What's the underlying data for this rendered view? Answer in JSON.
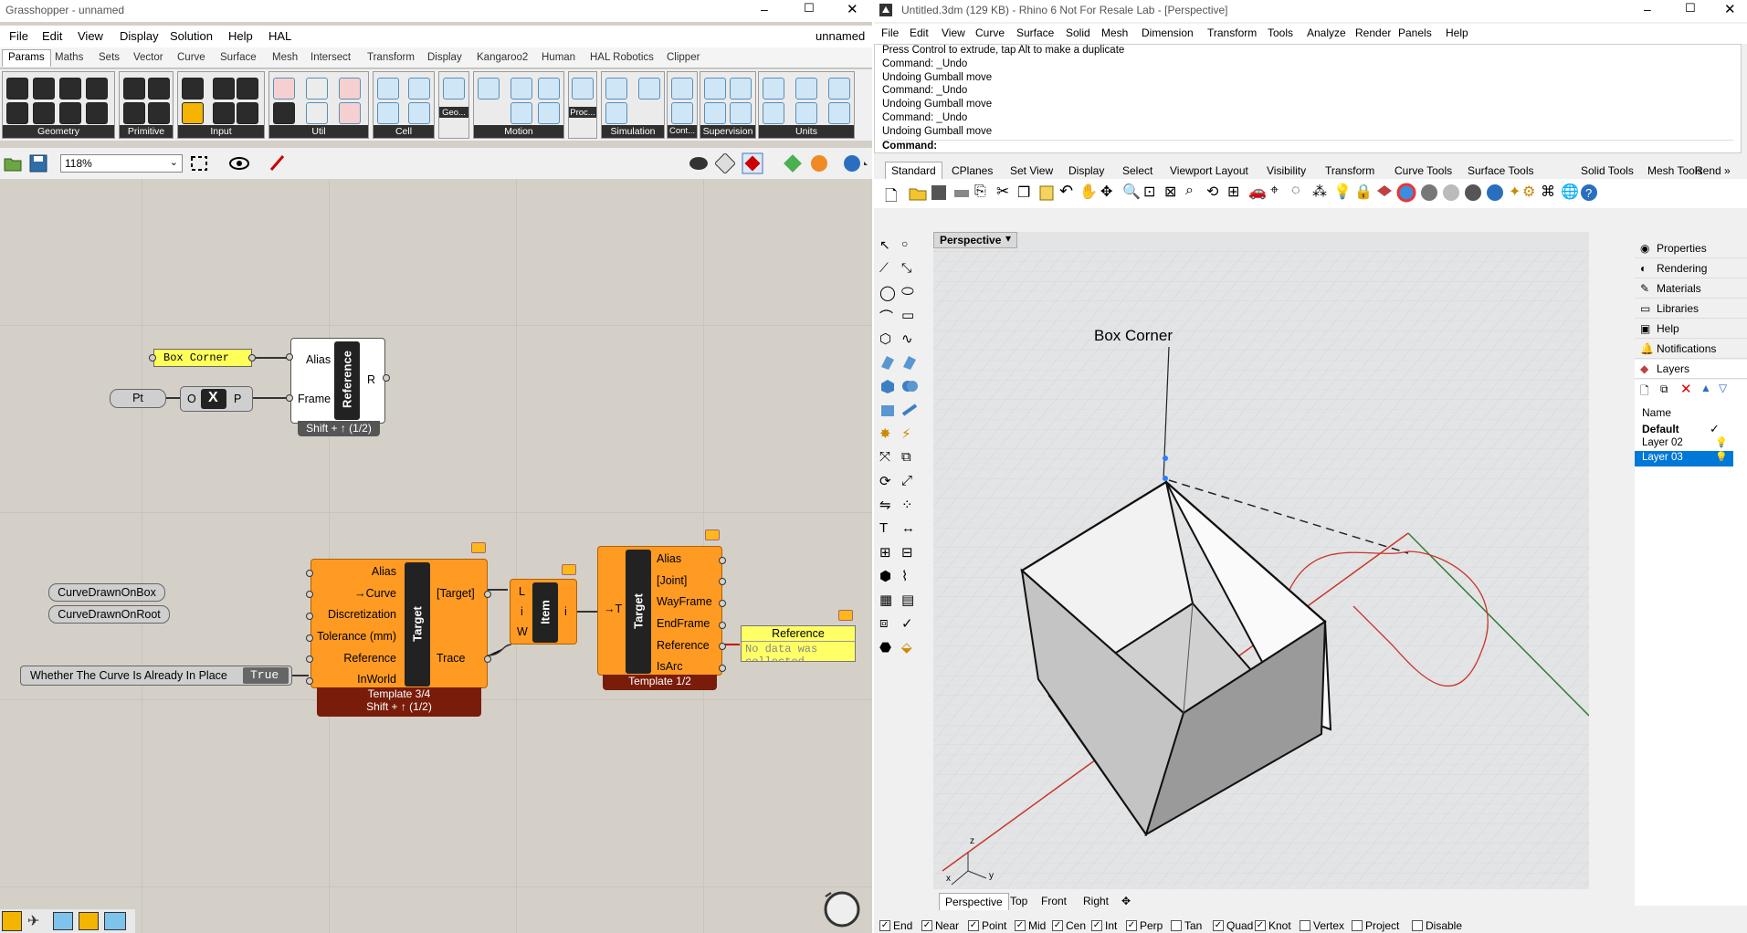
{
  "gh": {
    "title": "Grasshopper - unnamed",
    "doc_name": "unnamed",
    "menu": [
      "File",
      "Edit",
      "View",
      "Display",
      "Solution",
      "Help",
      "HAL"
    ],
    "tabs": [
      "Params",
      "Maths",
      "Sets",
      "Vector",
      "Curve",
      "Surface",
      "Mesh",
      "Intersect",
      "Transform",
      "Display",
      "Kangaroo2",
      "Human",
      "HAL Robotics",
      "Clipper"
    ],
    "groups": [
      "Geometry",
      "Primitive",
      "Input",
      "Util",
      "Cell",
      "Geo...",
      "Motion",
      "Proc...",
      "Simulation",
      "Cont...",
      "Supervision",
      "Units"
    ],
    "zoom": "118%",
    "canvas": {
      "box_corner": "Box Corner",
      "pt": "Pt",
      "x_comp": {
        "o": "O",
        "x": "X",
        "p": "P"
      },
      "ref1": {
        "alias": "Alias",
        "frame": "Frame",
        "cap": "Reference",
        "out": "R",
        "footer": "Shift + ↑ (1/2)"
      },
      "curve1": "CurveDrawnOnBox",
      "curve2": "CurveDrawnOnRoot",
      "bool_label": "Whether The Curve Is Already In Place",
      "bool_val": "True",
      "target1": {
        "inputs": [
          "Alias",
          "→Curve",
          "Discretization",
          "Tolerance (mm)",
          "Reference",
          "InWorld"
        ],
        "cap": "Target",
        "outputs": [
          "[Target]",
          "Trace"
        ],
        "footer1": "Template 3/4",
        "footer2": "Shift + ↑ (1/2)"
      },
      "item": {
        "l": "L",
        "i": "i",
        "w": "W",
        "cap": "Item",
        "out": "i"
      },
      "target2": {
        "input": "→T",
        "cap": "Target",
        "outputs": [
          "Alias",
          "[Joint]",
          "WayFrame",
          "EndFrame",
          "Reference",
          "IsArc"
        ],
        "footer": "Template 1/2"
      },
      "panel": {
        "title": "Reference",
        "text": "No data was collected"
      }
    }
  },
  "rhino": {
    "title": "Untitled.3dm (129 KB) - Rhino 6 Not For Resale Lab - [Perspective]",
    "menu": [
      "File",
      "Edit",
      "View",
      "Curve",
      "Surface",
      "Solid",
      "Mesh",
      "Dimension",
      "Transform",
      "Tools",
      "Analyze",
      "Render",
      "Panels",
      "Help"
    ],
    "history": [
      "Press Control to extrude, tap Alt to make a duplicate",
      "Command: _Undo",
      "Undoing Gumball move",
      "Command: _Undo",
      "Undoing Gumball move",
      "Command: _Undo",
      "Undoing Gumball move"
    ],
    "prompt": "Command:",
    "toolbar_tabs": [
      "Standard",
      "CPlanes",
      "Set View",
      "Display",
      "Select",
      "Viewport Layout",
      "Visibility",
      "Transform",
      "Curve Tools",
      "Surface Tools",
      "Solid Tools",
      "Mesh Tools",
      "Rend »"
    ],
    "viewport_name": "Perspective",
    "annotation": "Box Corner",
    "axes": {
      "x": "x",
      "y": "y",
      "z": "z"
    },
    "vp_tabs": [
      "Perspective",
      "Top",
      "Front",
      "Right"
    ],
    "panels": [
      "Properties",
      "Rendering",
      "Materials",
      "Libraries",
      "Help",
      "Notifications",
      "Layers"
    ],
    "layers": {
      "header": "Name",
      "rows": [
        "Default",
        "Layer 02",
        "Layer 03"
      ],
      "current_check": "✓",
      "selected": "Layer 03"
    },
    "osnaps": [
      {
        "label": "End",
        "on": true
      },
      {
        "label": "Near",
        "on": true
      },
      {
        "label": "Point",
        "on": true
      },
      {
        "label": "Mid",
        "on": true
      },
      {
        "label": "Cen",
        "on": true
      },
      {
        "label": "Int",
        "on": true
      },
      {
        "label": "Perp",
        "on": true
      },
      {
        "label": "Tan",
        "on": false
      },
      {
        "label": "Quad",
        "on": true
      },
      {
        "label": "Knot",
        "on": true
      },
      {
        "label": "Vertex",
        "on": false
      },
      {
        "label": "Project",
        "on": false
      },
      {
        "label": "Disable",
        "on": false
      }
    ]
  },
  "colors": {
    "gh_orange": "#ff9b22",
    "gh_canvas": "#d4d0c8",
    "layer_select": "#0078d7",
    "curve_red": "#c8362c",
    "axis_green": "#2e7d32"
  }
}
